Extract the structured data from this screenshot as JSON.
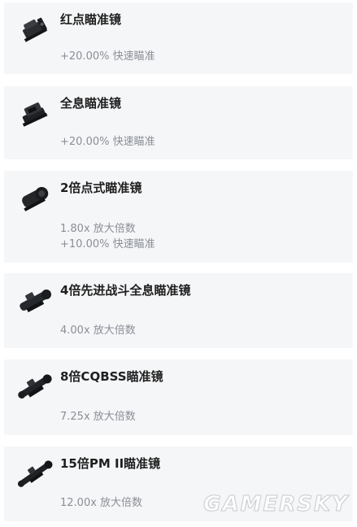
{
  "items": [
    {
      "title": "红点瞄准镜",
      "icon": "red-dot-scope-icon",
      "stats": [
        "+20.00% 快速瞄准"
      ]
    },
    {
      "title": "全息瞄准镜",
      "icon": "holographic-scope-icon",
      "stats": [
        "+20.00% 快速瞄准"
      ]
    },
    {
      "title": "2倍点式瞄准镜",
      "icon": "2x-scope-icon",
      "stats": [
        "1.80x 放大倍数",
        "+10.00% 快速瞄准"
      ]
    },
    {
      "title": "4倍先进战斗全息瞄准镜",
      "icon": "4x-acog-scope-icon",
      "stats": [
        "4.00x 放大倍数"
      ]
    },
    {
      "title": "8倍CQBSS瞄准镜",
      "icon": "8x-cqbss-scope-icon",
      "stats": [
        "7.25x 放大倍数"
      ]
    },
    {
      "title": "15倍PM II瞄准镜",
      "icon": "15x-pm2-scope-icon",
      "stats": [
        "12.00x 放大倍数"
      ]
    }
  ],
  "watermark": "GAMERSKY"
}
